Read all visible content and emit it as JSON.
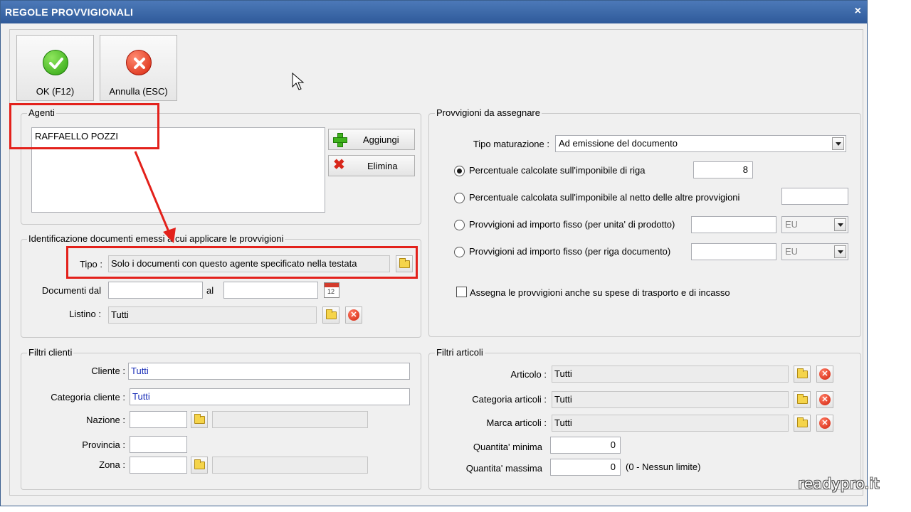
{
  "window": {
    "title": "REGOLE PROVVIGIONALI",
    "close_glyph": "×"
  },
  "toolbar": {
    "ok_label": "OK (F12)",
    "cancel_label": "Annulla (ESC)"
  },
  "agenti": {
    "legend": "Agenti",
    "items": [
      "RAFFAELLO POZZI"
    ],
    "add_label": "Aggiungi",
    "remove_label": "Elimina"
  },
  "identificazione": {
    "legend": "Identificazione documenti emessi a cui applicare le provvigioni",
    "tipo_label": "Tipo :",
    "tipo_value": "Solo i documenti con questo agente specificato nella testata",
    "documenti_dal_label": "Documenti dal",
    "documenti_dal_value": "",
    "al_label": "al",
    "al_value": "",
    "listino_label": "Listino :",
    "listino_value": "Tutti"
  },
  "provvigioni": {
    "legend": "Provvigioni da assegnare",
    "tipo_maturazione_label": "Tipo maturazione :",
    "tipo_maturazione_value": "Ad emissione del documento",
    "options": [
      {
        "label": "Percentuale calcolate sull'imponibile di riga",
        "value": "8",
        "selected": true
      },
      {
        "label": "Percentuale calcolata sull'imponibile al netto delle altre provvigioni",
        "value": "",
        "selected": false
      },
      {
        "label": "Provvigioni ad importo fisso (per unita' di prodotto)",
        "value": "",
        "currency": "EU",
        "selected": false
      },
      {
        "label": "Provvigioni ad importo fisso (per riga documento)",
        "value": "",
        "currency": "EU",
        "selected": false
      }
    ],
    "spese_label": "Assegna le provvigioni anche su spese di trasporto e di incasso"
  },
  "filtri_clienti": {
    "legend": "Filtri clienti",
    "cliente_label": "Cliente :",
    "cliente_value": "Tutti",
    "categoria_label": "Categoria cliente :",
    "categoria_value": "Tutti",
    "nazione_label": "Nazione :",
    "provincia_label": "Provincia :",
    "zona_label": "Zona :"
  },
  "filtri_articoli": {
    "legend": "Filtri articoli",
    "articolo_label": "Articolo :",
    "articolo_value": "Tutti",
    "categoria_label": "Categoria articoli :",
    "categoria_value": "Tutti",
    "marca_label": "Marca articoli :",
    "marca_value": "Tutti",
    "qta_min_label": "Quantita' minima",
    "qta_min_value": "0",
    "qta_max_label": "Quantita' massima",
    "qta_max_value": "0",
    "qta_max_note": "(0 - Nessun limite)"
  },
  "watermark": "readypro.it",
  "colors": {
    "titlebar": "#2f5a9a",
    "highlight": "#e3211b",
    "link_text": "#1a2fb8"
  }
}
